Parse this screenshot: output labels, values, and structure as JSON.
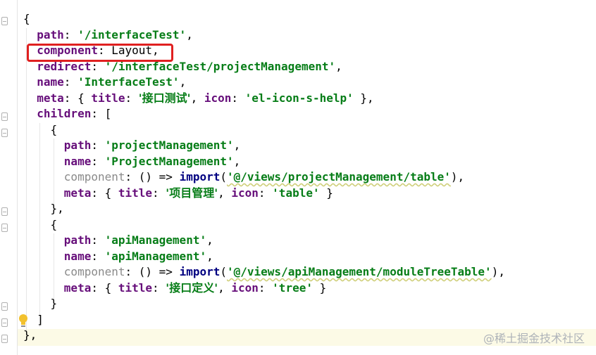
{
  "editor": {
    "lines": [
      [
        {
          "t": "{",
          "c": "p"
        }
      ],
      [
        {
          "t": "  path",
          "c": "k"
        },
        {
          "t": ": ",
          "c": "p"
        },
        {
          "t": "'/interfaceTest'",
          "c": "s"
        },
        {
          "t": ",",
          "c": "p"
        }
      ],
      [
        {
          "t": "  component",
          "c": "k"
        },
        {
          "t": ": Layout,",
          "c": "p"
        }
      ],
      [
        {
          "t": "  redirect",
          "c": "k"
        },
        {
          "t": ": ",
          "c": "p"
        },
        {
          "t": "'/interfaceTest/projectManagement'",
          "c": "s"
        },
        {
          "t": ",",
          "c": "p"
        }
      ],
      [
        {
          "t": "  name",
          "c": "k"
        },
        {
          "t": ": ",
          "c": "p"
        },
        {
          "t": "'InterfaceTest'",
          "c": "s"
        },
        {
          "t": ",",
          "c": "p"
        }
      ],
      [
        {
          "t": "  meta",
          "c": "k"
        },
        {
          "t": ": { ",
          "c": "p"
        },
        {
          "t": "title",
          "c": "k"
        },
        {
          "t": ": ",
          "c": "p"
        },
        {
          "t": "'接口测试'",
          "c": "s cjk"
        },
        {
          "t": ", ",
          "c": "p"
        },
        {
          "t": "icon",
          "c": "k"
        },
        {
          "t": ": ",
          "c": "p"
        },
        {
          "t": "'el-icon-s-help'",
          "c": "s"
        },
        {
          "t": " },",
          "c": "p"
        }
      ],
      [
        {
          "t": "  children",
          "c": "k"
        },
        {
          "t": ": [",
          "c": "p"
        }
      ],
      [
        {
          "t": "    {",
          "c": "p"
        }
      ],
      [
        {
          "t": "      path",
          "c": "k"
        },
        {
          "t": ": ",
          "c": "p"
        },
        {
          "t": "'projectManagement'",
          "c": "s"
        },
        {
          "t": ",",
          "c": "p"
        }
      ],
      [
        {
          "t": "      name",
          "c": "k"
        },
        {
          "t": ": ",
          "c": "p"
        },
        {
          "t": "'ProjectManagement'",
          "c": "s"
        },
        {
          "t": ",",
          "c": "p"
        }
      ],
      [
        {
          "t": "      component",
          "c": "dim"
        },
        {
          "t": ": () => ",
          "c": "p"
        },
        {
          "t": "import",
          "c": "fn"
        },
        {
          "t": "(",
          "c": "p"
        },
        {
          "t": "'@/views/projectManagement/table'",
          "c": "s squig"
        },
        {
          "t": "),",
          "c": "p"
        }
      ],
      [
        {
          "t": "      meta",
          "c": "k"
        },
        {
          "t": ": { ",
          "c": "p"
        },
        {
          "t": "title",
          "c": "k"
        },
        {
          "t": ": ",
          "c": "p"
        },
        {
          "t": "'项目管理'",
          "c": "s cjk"
        },
        {
          "t": ", ",
          "c": "p"
        },
        {
          "t": "icon",
          "c": "k"
        },
        {
          "t": ": ",
          "c": "p"
        },
        {
          "t": "'table'",
          "c": "s"
        },
        {
          "t": " }",
          "c": "p"
        }
      ],
      [
        {
          "t": "    },",
          "c": "p"
        }
      ],
      [
        {
          "t": "    {",
          "c": "p"
        }
      ],
      [
        {
          "t": "      path",
          "c": "k"
        },
        {
          "t": ": ",
          "c": "p"
        },
        {
          "t": "'apiManagement'",
          "c": "s"
        },
        {
          "t": ",",
          "c": "p"
        }
      ],
      [
        {
          "t": "      name",
          "c": "k"
        },
        {
          "t": ": ",
          "c": "p"
        },
        {
          "t": "'apiManagement'",
          "c": "s"
        },
        {
          "t": ",",
          "c": "p"
        }
      ],
      [
        {
          "t": "      component",
          "c": "dim"
        },
        {
          "t": ": () => ",
          "c": "p"
        },
        {
          "t": "import",
          "c": "fn"
        },
        {
          "t": "(",
          "c": "p"
        },
        {
          "t": "'@/views/apiManagement/moduleTreeTable'",
          "c": "s squig"
        },
        {
          "t": "),",
          "c": "p"
        }
      ],
      [
        {
          "t": "      meta",
          "c": "k"
        },
        {
          "t": ": { ",
          "c": "p"
        },
        {
          "t": "title",
          "c": "k"
        },
        {
          "t": ": ",
          "c": "p"
        },
        {
          "t": "'接口定义'",
          "c": "s cjk"
        },
        {
          "t": ", ",
          "c": "p"
        },
        {
          "t": "icon",
          "c": "k"
        },
        {
          "t": ": ",
          "c": "p"
        },
        {
          "t": "'tree'",
          "c": "s"
        },
        {
          "t": " }",
          "c": "p"
        }
      ],
      [
        {
          "t": "    }",
          "c": "p"
        }
      ],
      [
        {
          "t": "  ]",
          "c": "p"
        }
      ],
      [
        {
          "t": "},",
          "c": "p"
        }
      ]
    ]
  },
  "icons": {
    "bulb": "lightbulb-icon",
    "fold": "fold-marker-icon"
  },
  "colors": {
    "keyword": "#660e7a",
    "string": "#067d17",
    "highlight_box": "#e02020",
    "caret_line": "#fcfae6"
  },
  "watermark": "@稀土掘金技术社区"
}
